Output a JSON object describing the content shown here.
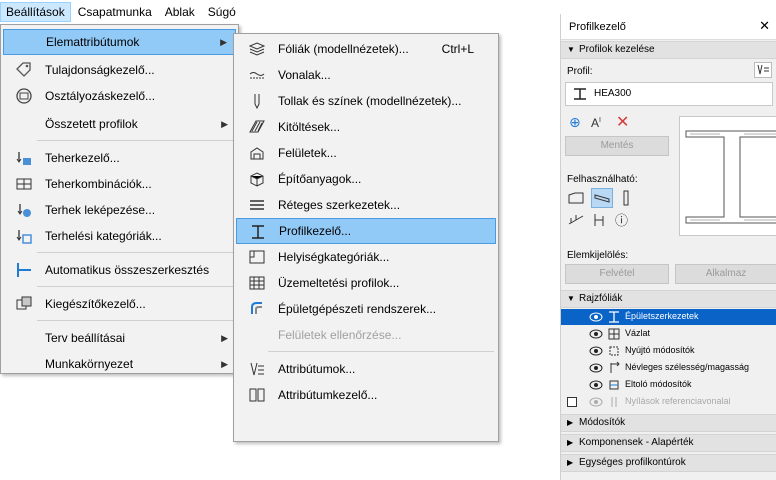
{
  "menubar": {
    "items": [
      {
        "label": "Beállítások",
        "active": true
      },
      {
        "label": "Csapatmunka"
      },
      {
        "label": "Ablak"
      },
      {
        "label": "Súgó"
      }
    ]
  },
  "menu1": {
    "items": [
      {
        "label": "Elemattribútumok",
        "icon": "none",
        "arrow": "▶"
      },
      {
        "label": "Tulajdonságkezelő...",
        "icon": "tag-icon"
      },
      {
        "label": "Osztályozáskezelő...",
        "icon": "classification-icon"
      },
      {
        "label": "Összetett profilok",
        "icon": "none",
        "arrow": "▶"
      },
      {
        "label": "Teherkezelő...",
        "icon": "load-manager-icon"
      },
      {
        "label": "Teherkombinációk...",
        "icon": "load-combination-icon"
      },
      {
        "label": "Terhek leképezése...",
        "icon": "load-mapping-icon"
      },
      {
        "label": "Terhelési kategóriák...",
        "icon": "load-category-icon"
      },
      {
        "label": "Automatikus összeszerkesztés",
        "icon": "auto-assembly-icon"
      },
      {
        "label": "Kiegészítőkezelő...",
        "icon": "addon-manager-icon"
      },
      {
        "label": "Terv beállításai",
        "icon": "none",
        "arrow": "▶"
      },
      {
        "label": "Munkakörnyezet",
        "icon": "none",
        "arrow": "▶"
      }
    ]
  },
  "menu2": {
    "items": [
      {
        "label": "Fóliák (modellnézetek)...",
        "shortcut": "Ctrl+L",
        "icon": "layers-icon"
      },
      {
        "label": "Vonalak...",
        "icon": "line-types-icon"
      },
      {
        "label": "Tollak és színek (modellnézetek)...",
        "icon": "pen-icon"
      },
      {
        "label": "Kitöltések...",
        "icon": "fill-icon"
      },
      {
        "label": "Felületek...",
        "icon": "surface-icon"
      },
      {
        "label": "Építőanyagok...",
        "icon": "building-material-icon"
      },
      {
        "label": "Réteges szerkezetek...",
        "icon": "composite-icon"
      },
      {
        "label": "Profilkezelő...",
        "icon": "profile-manager-icon",
        "selected": true
      },
      {
        "label": "Helyiségkategóriák...",
        "icon": "zone-category-icon"
      },
      {
        "label": "Üzemeltetési profilok...",
        "icon": "operation-profile-icon"
      },
      {
        "label": "Épületgépészeti rendszerek...",
        "icon": "mep-systems-icon"
      },
      {
        "label": "Felületek ellenőrzése...",
        "icon": "none",
        "disabled": true
      },
      {
        "label": "Attribútumok...",
        "icon": "attributes-icon"
      },
      {
        "label": "Attribútumkezelő...",
        "icon": "attribute-manager-icon"
      }
    ]
  },
  "panel": {
    "title": "Profilkezelő",
    "close": "✕",
    "section_manage": "Profilok kezelése",
    "profile_label": "Profil:",
    "profile_name": "HEA300",
    "save_label": "Mentés",
    "usable_label": "Felhasználható:",
    "element_select_label": "Elemkijelölés:",
    "pick_label": "Felvétel",
    "apply_label": "Alkalmaz",
    "section_drawing_layers": "Rajzfóliák",
    "layers": [
      {
        "label": "Épületszerkezetek",
        "selected": true
      },
      {
        "label": "Vázlat"
      },
      {
        "label": "Nyújtó módosítók"
      },
      {
        "label": "Névleges szélesség/magasság"
      },
      {
        "label": "Eltoló módosítók"
      },
      {
        "label": "Nyílások referenciavonalai",
        "dim": true
      }
    ],
    "collapsed_sections": [
      "Módosítók",
      "Komponensek - Alapérték",
      "Egységes profilkontúrok"
    ]
  },
  "colors": {
    "menu_selected": "#91c9f7",
    "panel_selected": "#0a64c8",
    "delete_x": "#d83b3b",
    "add_blue": "#1e7bd6"
  }
}
